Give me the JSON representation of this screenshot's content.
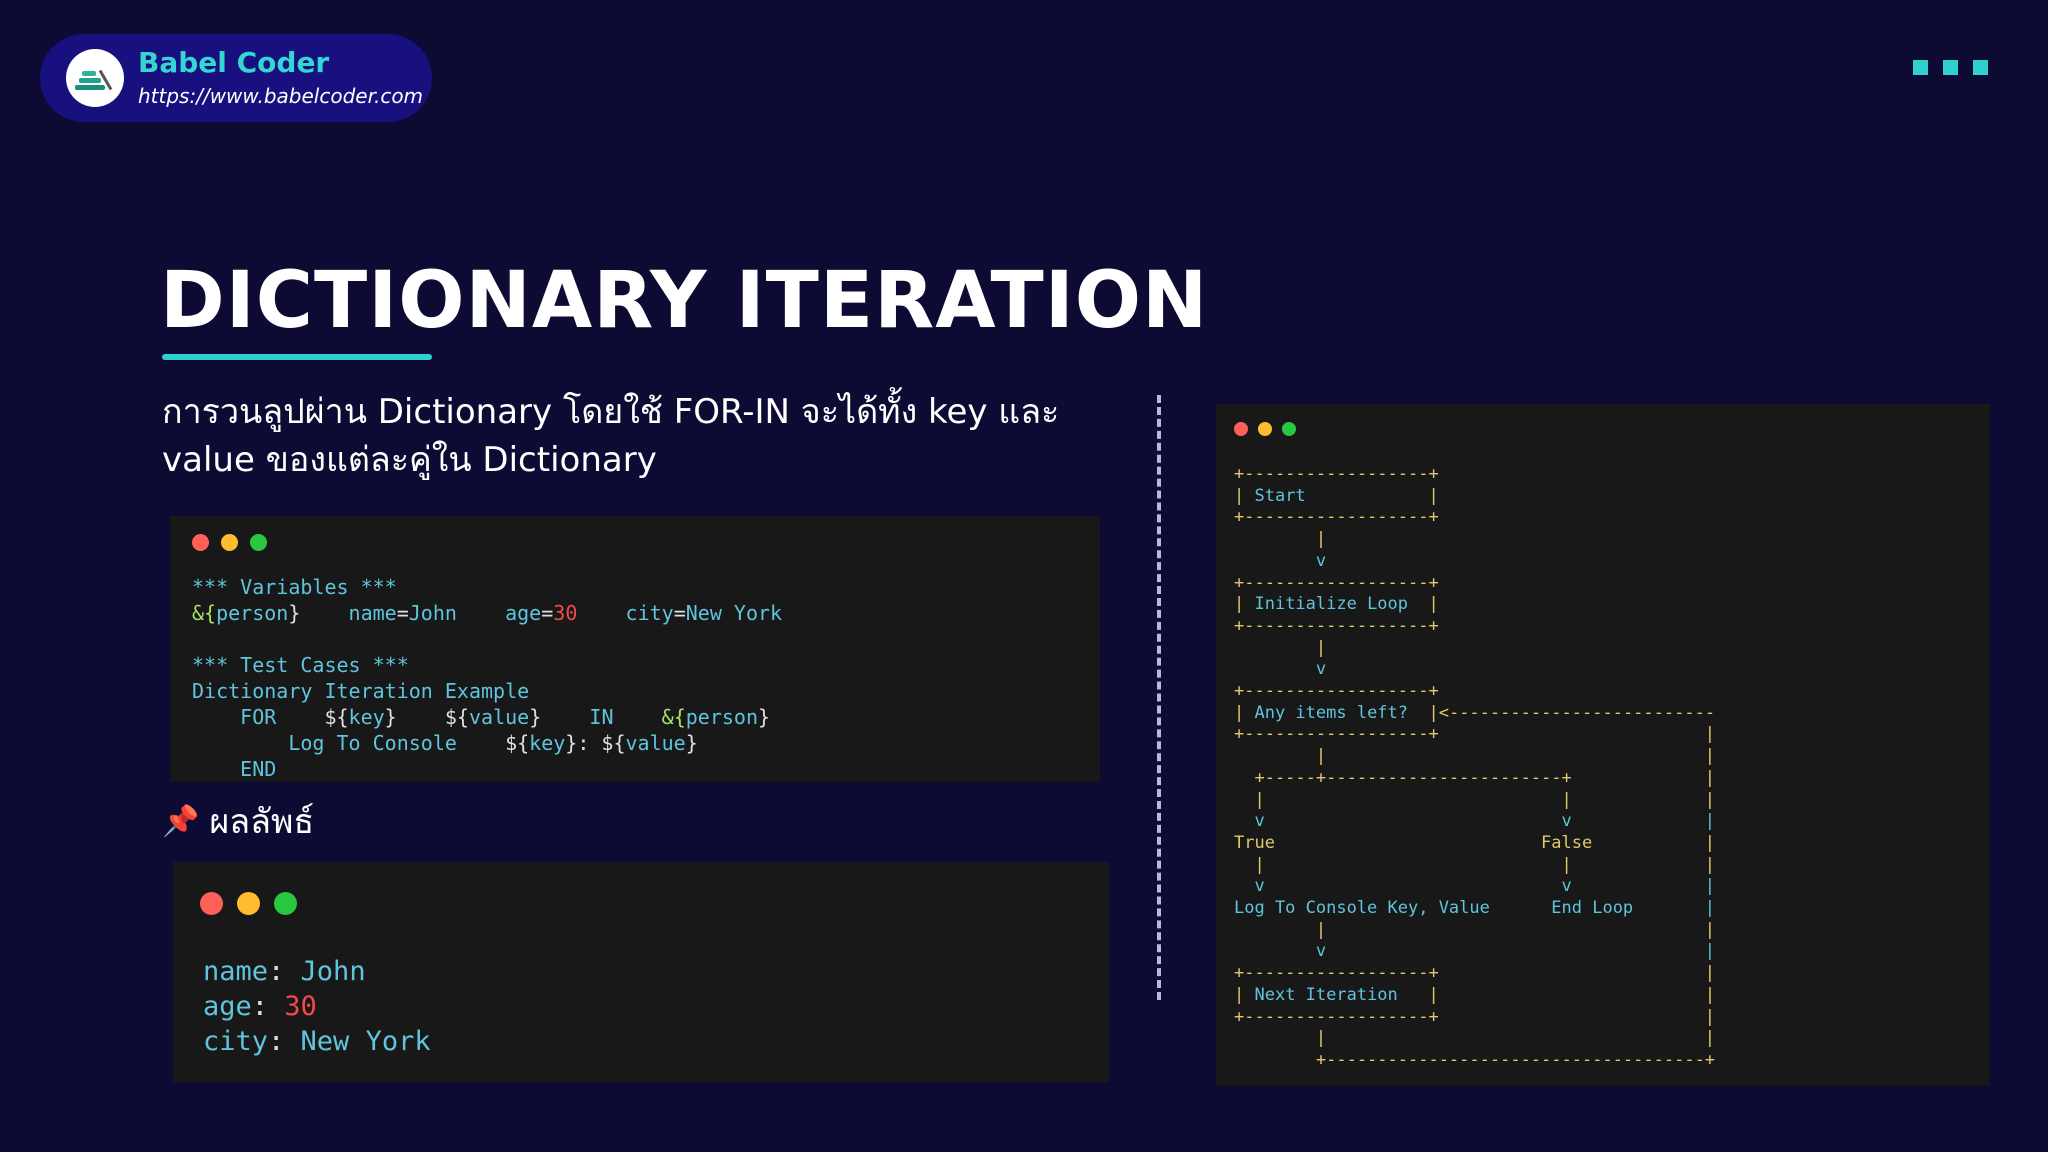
{
  "brand": {
    "name": "Babel Coder",
    "url": "https://www.babelcoder.com",
    "logo_icon": "babel-coder-logo-icon"
  },
  "decor": {
    "corner_icon": "three-squares-icon",
    "accent": "#2fd0d0"
  },
  "title": "DICTIONARY ITERATION",
  "description": "การวนลูปผ่าน Dictionary โดยใช้ FOR-IN จะได้ทั้ง key และ value ของแต่ละคู่ใน Dictionary",
  "code": {
    "window_controls": [
      "close",
      "minimize",
      "maximize"
    ],
    "lines": [
      [
        {
          "t": "*** Variables ***",
          "c": "teal"
        }
      ],
      [
        {
          "t": "&{",
          "c": "grn"
        },
        {
          "t": "person",
          "c": "teal"
        },
        {
          "t": "}",
          "c": "wht"
        },
        {
          "t": "    name",
          "c": "teal"
        },
        {
          "t": "=",
          "c": "wht"
        },
        {
          "t": "John",
          "c": "teal"
        },
        {
          "t": "    age",
          "c": "teal"
        },
        {
          "t": "=",
          "c": "wht"
        },
        {
          "t": "30",
          "c": "red"
        },
        {
          "t": "    city",
          "c": "teal"
        },
        {
          "t": "=",
          "c": "wht"
        },
        {
          "t": "New York",
          "c": "teal"
        }
      ],
      [
        {
          "t": "",
          "c": "teal"
        }
      ],
      [
        {
          "t": "*** Test Cases ***",
          "c": "teal"
        }
      ],
      [
        {
          "t": "Dictionary Iteration Example",
          "c": "teal"
        }
      ],
      [
        {
          "t": "    FOR    ",
          "c": "teal"
        },
        {
          "t": "${",
          "c": "wht"
        },
        {
          "t": "key",
          "c": "teal"
        },
        {
          "t": "}    ",
          "c": "wht"
        },
        {
          "t": "${",
          "c": "wht"
        },
        {
          "t": "value",
          "c": "teal"
        },
        {
          "t": "}    ",
          "c": "wht"
        },
        {
          "t": "IN    ",
          "c": "teal"
        },
        {
          "t": "&{",
          "c": "grn"
        },
        {
          "t": "person",
          "c": "teal"
        },
        {
          "t": "}",
          "c": "wht"
        }
      ],
      [
        {
          "t": "        Log To Console    ",
          "c": "teal"
        },
        {
          "t": "${",
          "c": "wht"
        },
        {
          "t": "key",
          "c": "teal"
        },
        {
          "t": "}: ",
          "c": "wht"
        },
        {
          "t": "${",
          "c": "wht"
        },
        {
          "t": "value",
          "c": "teal"
        },
        {
          "t": "}",
          "c": "wht"
        }
      ],
      [
        {
          "t": "    END",
          "c": "teal"
        }
      ]
    ]
  },
  "result": {
    "label": "ผลลัพธ์",
    "icon": "pushpin-icon",
    "lines": [
      [
        {
          "t": "name",
          "c": "teal"
        },
        {
          "t": ": ",
          "c": "wht"
        },
        {
          "t": "John",
          "c": "teal"
        }
      ],
      [
        {
          "t": "age",
          "c": "teal"
        },
        {
          "t": ": ",
          "c": "wht"
        },
        {
          "t": "30",
          "c": "red"
        }
      ],
      [
        {
          "t": "city",
          "c": "teal"
        },
        {
          "t": ": ",
          "c": "wht"
        },
        {
          "t": "New York",
          "c": "teal"
        }
      ]
    ]
  },
  "flowchart": {
    "lines": [
      [
        {
          "t": "+------------------+",
          "c": "yel"
        }
      ],
      [
        {
          "t": "| ",
          "c": "yel"
        },
        {
          "t": "Start",
          "c": "teal"
        },
        {
          "t": "            |",
          "c": "yel"
        }
      ],
      [
        {
          "t": "+------------------+",
          "c": "yel"
        }
      ],
      [
        {
          "t": "        |",
          "c": "yel"
        }
      ],
      [
        {
          "t": "        v",
          "c": "teal"
        }
      ],
      [
        {
          "t": "+------------------+",
          "c": "yel"
        }
      ],
      [
        {
          "t": "| ",
          "c": "yel"
        },
        {
          "t": "Initialize Loop",
          "c": "teal"
        },
        {
          "t": "  |",
          "c": "yel"
        }
      ],
      [
        {
          "t": "+------------------+",
          "c": "yel"
        }
      ],
      [
        {
          "t": "        |",
          "c": "yel"
        }
      ],
      [
        {
          "t": "        v",
          "c": "teal"
        }
      ],
      [
        {
          "t": "+------------------+",
          "c": "yel"
        }
      ],
      [
        {
          "t": "| ",
          "c": "yel"
        },
        {
          "t": "Any items left?",
          "c": "teal"
        },
        {
          "t": "  |<--------------------------",
          "c": "yel"
        }
      ],
      [
        {
          "t": "+------------------+                          |",
          "c": "yel"
        }
      ],
      [
        {
          "t": "        |                                     |",
          "c": "yel"
        }
      ],
      [
        {
          "t": "  +-----+-----------------------+             |",
          "c": "yel"
        }
      ],
      [
        {
          "t": "  |                             |             |",
          "c": "yel"
        }
      ],
      [
        {
          "t": "  v                             v             |",
          "c": "teal"
        }
      ],
      [
        {
          "t": "True                          False           |",
          "c": "yel"
        }
      ],
      [
        {
          "t": "  |                             |             |",
          "c": "yel"
        }
      ],
      [
        {
          "t": "  v                             v             |",
          "c": "teal"
        }
      ],
      [
        {
          "t": "Log To Console Key, Value      End Loop       |",
          "c": "teal"
        }
      ],
      [
        {
          "t": "        |                                     |",
          "c": "yel"
        }
      ],
      [
        {
          "t": "        v                                     |",
          "c": "teal"
        }
      ],
      [
        {
          "t": "+------------------+                          |",
          "c": "yel"
        }
      ],
      [
        {
          "t": "| ",
          "c": "yel"
        },
        {
          "t": "Next Iteration",
          "c": "teal"
        },
        {
          "t": "   |                          |",
          "c": "yel"
        }
      ],
      [
        {
          "t": "+------------------+                          |",
          "c": "yel"
        }
      ],
      [
        {
          "t": "        |                                     |",
          "c": "yel"
        }
      ],
      [
        {
          "t": "        +-------------------------------------+",
          "c": "yel"
        }
      ]
    ]
  }
}
